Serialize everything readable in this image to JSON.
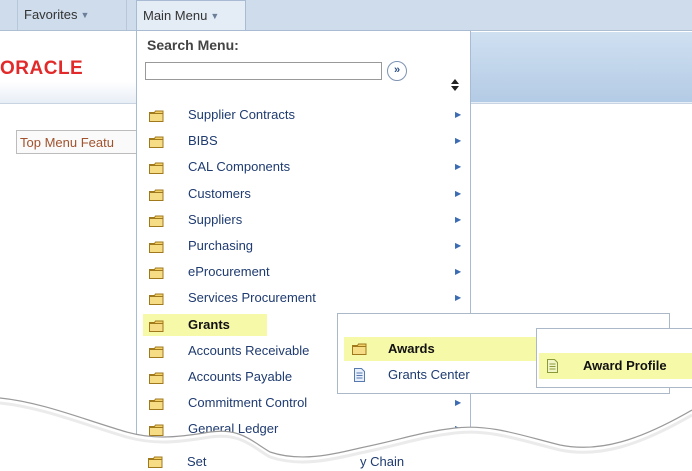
{
  "nav": {
    "favorites_label": "Favorites",
    "main_menu_label": "Main Menu"
  },
  "header": {
    "logo_text": "ORACLE",
    "top_feature_label": "Top Menu Featu"
  },
  "search": {
    "label": "Search Menu:",
    "value": "",
    "go_icon": "double-chevron-right-icon",
    "go_symbol": "»"
  },
  "menu": {
    "items": [
      {
        "label": "Supplier Contracts",
        "has_submenu": true
      },
      {
        "label": "BIBS",
        "has_submenu": true
      },
      {
        "label": "CAL Components",
        "has_submenu": true
      },
      {
        "label": "Customers",
        "has_submenu": true
      },
      {
        "label": "Suppliers",
        "has_submenu": true
      },
      {
        "label": "Purchasing",
        "has_submenu": true
      },
      {
        "label": "eProcurement",
        "has_submenu": true
      },
      {
        "label": "Services Procurement",
        "has_submenu": true
      },
      {
        "label": "Grants",
        "has_submenu": true,
        "active": true
      },
      {
        "label": "Accounts Receivable",
        "has_submenu": true
      },
      {
        "label": "Accounts Payable",
        "has_submenu": true
      },
      {
        "label": "Commitment Control",
        "has_submenu": true
      },
      {
        "label": "General Ledger",
        "has_submenu": true
      },
      {
        "label": "Set",
        "partial_label_right": "y Chain",
        "has_submenu": true
      }
    ]
  },
  "grants_submenu": {
    "items": [
      {
        "label": "Awards",
        "icon": "folder-icon",
        "active": true
      },
      {
        "label": "Grants Center",
        "icon": "page-icon"
      }
    ]
  },
  "awards_submenu": {
    "items": [
      {
        "label": "Award Profile",
        "icon": "page-icon",
        "active": true
      }
    ]
  },
  "colors": {
    "highlight": "#f6f9a8",
    "menu_text": "#1f3b70",
    "topbar": "#cfdcec",
    "logo": "#e22a2a",
    "folder": "#f2cf67"
  }
}
